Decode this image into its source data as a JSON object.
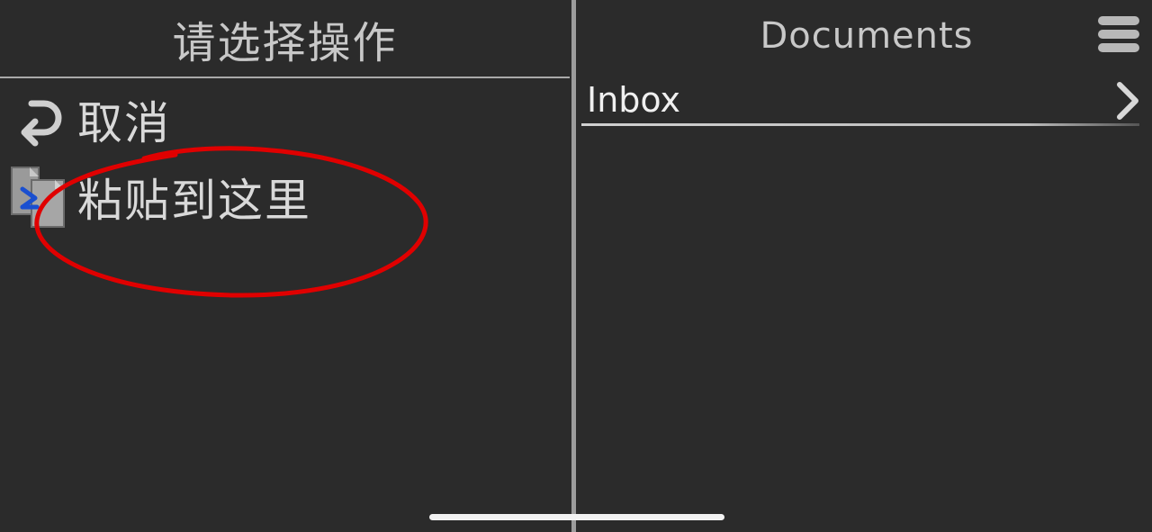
{
  "left_panel": {
    "title": "请选择操作",
    "items": [
      {
        "label": "取消",
        "icon": "undo-icon"
      },
      {
        "label": "粘贴到这里",
        "icon": "paste-icon"
      }
    ]
  },
  "right_panel": {
    "title": "Documents",
    "menu_icon": "hamburger-menu-icon",
    "folders": [
      {
        "name": "Inbox",
        "icon": "chevron-right-icon"
      }
    ]
  },
  "colors": {
    "background": "#2b2b2b",
    "text": "#d9d9d9",
    "annotation": "#e00000",
    "paste_accent": "#1a4fd0"
  }
}
